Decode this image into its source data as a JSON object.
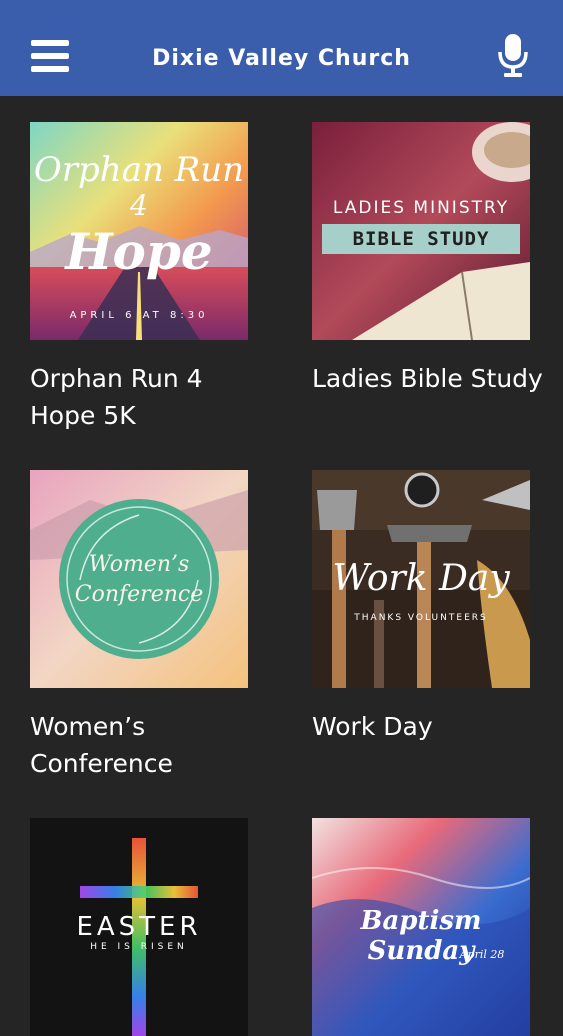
{
  "header": {
    "title": "Dixie Valley Church",
    "menu_icon": "hamburger-menu-icon",
    "mic_icon": "microphone-icon",
    "bar_color": "#3b5eac"
  },
  "cards": [
    {
      "label": "Orphan Run 4 Hope 5K",
      "image_text": {
        "line1": "Orphan Run",
        "line2": "4",
        "line3": "Hope",
        "date": "APRIL 6 AT 8:30"
      }
    },
    {
      "label": "Ladies Bible Study",
      "image_text": {
        "line1": "LADIES MINISTRY",
        "line2": "BIBLE STUDY"
      }
    },
    {
      "label": "Women’s Conference",
      "image_text": {
        "line1": "Women’s",
        "line2": "Conference"
      }
    },
    {
      "label": "Work Day",
      "image_text": {
        "line1": "Work Day",
        "line2": "THANKS VOLUNTEERS"
      }
    },
    {
      "label": "",
      "image_text": {
        "line1": "EASTER",
        "line2": "HE IS RISEN"
      }
    },
    {
      "label": "",
      "image_text": {
        "line1": "Baptism Sunday",
        "line2": "April 28"
      }
    }
  ],
  "colors": {
    "background": "#252526",
    "text": "#ffffff"
  }
}
